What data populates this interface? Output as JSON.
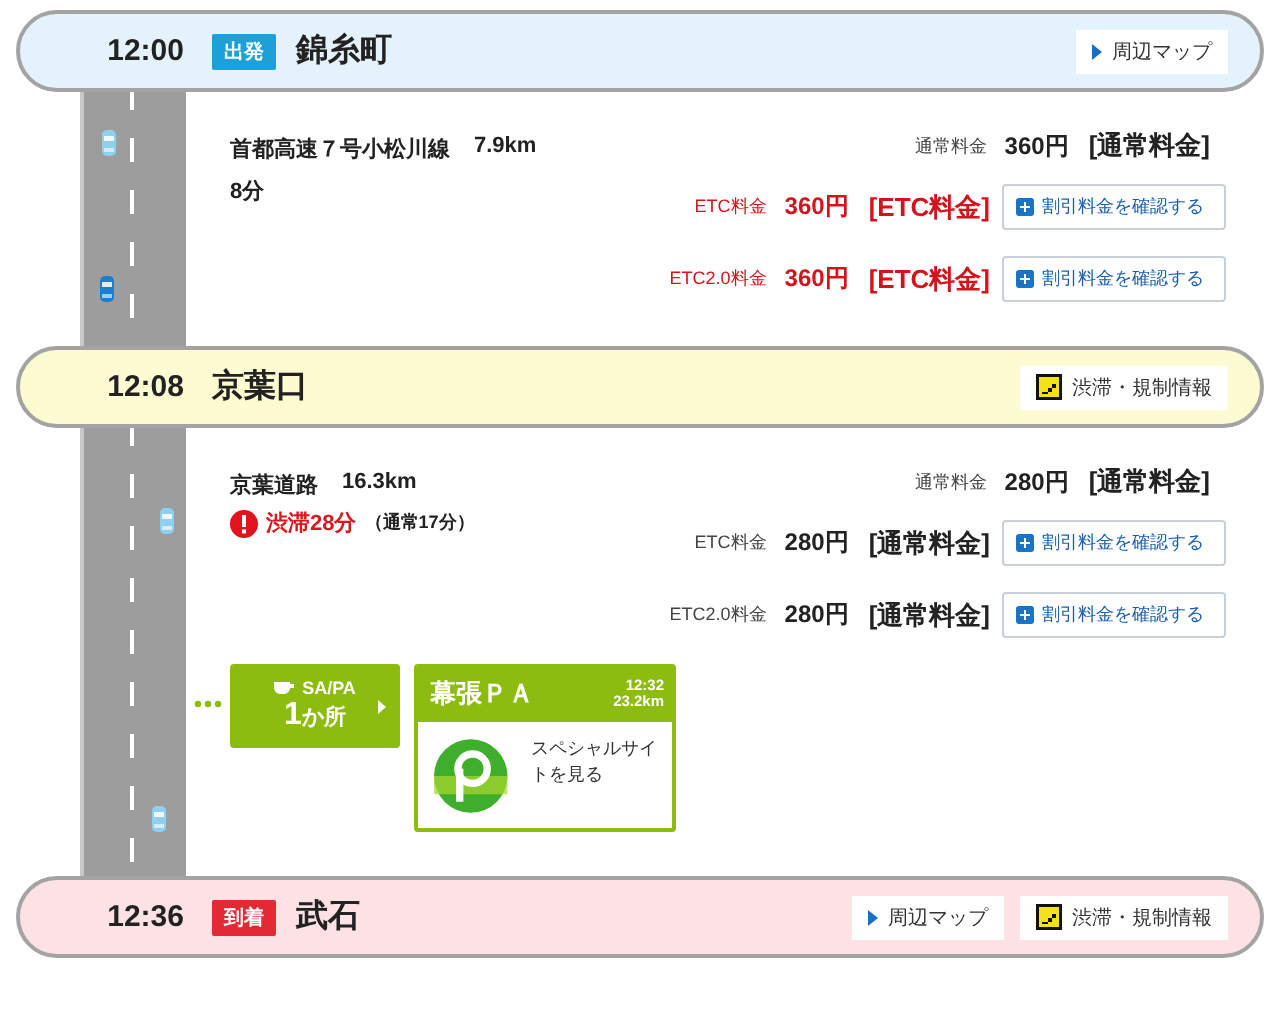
{
  "route": [
    {
      "kind": "depart",
      "time": "12:00",
      "badge": "出発",
      "name": "錦糸町",
      "buttons": [
        {
          "kind": "map",
          "label": "周辺マップ"
        }
      ]
    },
    {
      "kind": "segment",
      "road": "首都高速７号小松川線",
      "distance": "7.9km",
      "duration": "8分",
      "fares": [
        {
          "label": "通常料金",
          "price": "360円",
          "fare_type": "[通常料金]",
          "alert": false
        },
        {
          "label": "ETC料金",
          "price": "360円",
          "fare_type": "[ETC料金]",
          "alert": true,
          "button": "割引料金を確認する"
        },
        {
          "label": "ETC2.0料金",
          "price": "360円",
          "fare_type": "[ETC料金]",
          "alert": true,
          "button": "割引料金を確認する"
        }
      ]
    },
    {
      "kind": "via",
      "time": "12:08",
      "name": "京葉口",
      "buttons": [
        {
          "kind": "traffic",
          "label": "渋滞・規制情報"
        }
      ]
    },
    {
      "kind": "segment",
      "road": "京葉道路",
      "distance": "16.3km",
      "congestion": {
        "delay": "渋滞28分",
        "normal": "（通常17分）"
      },
      "fares": [
        {
          "label": "通常料金",
          "price": "280円",
          "fare_type": "[通常料金]",
          "alert": false
        },
        {
          "label": "ETC料金",
          "price": "280円",
          "fare_type": "[通常料金]",
          "alert": false,
          "button": "割引料金を確認する"
        },
        {
          "label": "ETC2.0料金",
          "price": "280円",
          "fare_type": "[通常料金]",
          "alert": false,
          "button": "割引料金を確認する"
        }
      ],
      "sapa": {
        "label": "SA/PA",
        "count": "1",
        "unit": "か所",
        "areas": [
          {
            "name": "幕張ＰＡ",
            "time": "12:32",
            "distance": "23.2km",
            "link": "スペシャルサイトを見る"
          }
        ]
      }
    },
    {
      "kind": "arrive",
      "time": "12:36",
      "badge": "到着",
      "name": "武石",
      "buttons": [
        {
          "kind": "map",
          "label": "周辺マップ"
        },
        {
          "kind": "traffic",
          "label": "渋滞・規制情報"
        }
      ]
    }
  ]
}
